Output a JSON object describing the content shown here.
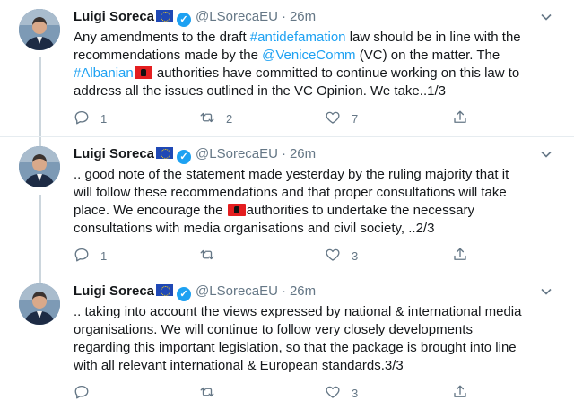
{
  "author": {
    "name": "Luigi Soreca",
    "handle": "@LSorecaEU",
    "separator": "·",
    "time": "26m",
    "verified_glyph": "✓"
  },
  "tweets": [
    {
      "lines": [
        [
          {
            "t": "Any amendments to the draft "
          },
          {
            "t": "#antidefamation",
            "link": true
          },
          {
            "t": " law should be in line with the"
          }
        ],
        [
          {
            "t": "recommendations made by the "
          },
          {
            "t": "@VeniceComm",
            "link": true
          },
          {
            "t": " (VC) on the matter. The"
          }
        ],
        [
          {
            "t": "#Albanian",
            "link": true
          },
          {
            "flag": "albania-flag"
          },
          {
            "t": " authorities have committed to continue working on this law to"
          }
        ],
        [
          {
            "t": "address all the issues outlined in the VC Opinion. We take..1/3"
          }
        ]
      ],
      "replies": "1",
      "retweets": "2",
      "likes": "7"
    },
    {
      "lines": [
        [
          {
            "t": ".. good note of the statement made yesterday by the ruling majority that it"
          }
        ],
        [
          {
            "t": "will follow these recommendations and that proper consultations will take"
          }
        ],
        [
          {
            "t": "place. We encourage the "
          },
          {
            "flag": "albania-flag"
          },
          {
            "t": "authorities to undertake the necessary"
          }
        ],
        [
          {
            "t": "consultations with media organisations and civil society, ..2/3"
          }
        ]
      ],
      "replies": "1",
      "retweets": "",
      "likes": "3"
    },
    {
      "lines": [
        [
          {
            "t": ".. taking into account the views expressed by national & international media"
          }
        ],
        [
          {
            "t": "organisations. We will continue to follow very closely developments"
          }
        ],
        [
          {
            "t": "regarding this important legislation, so that the package is brought into line"
          }
        ],
        [
          {
            "t": "with all relevant international & European standards.3/3"
          }
        ]
      ],
      "replies": "",
      "retweets": "",
      "likes": "3"
    }
  ],
  "icons": {
    "reply": "reply-icon",
    "retweet": "retweet-icon",
    "like": "heart-icon",
    "share": "share-icon",
    "more": "chevron-down-icon",
    "flag_author": "eu-flag-icon",
    "flag_body": "albania-flag-icon"
  },
  "colors": {
    "link": "#1da1f2",
    "text": "#14171a",
    "muted": "#657786",
    "divider": "#e6ecf0"
  }
}
